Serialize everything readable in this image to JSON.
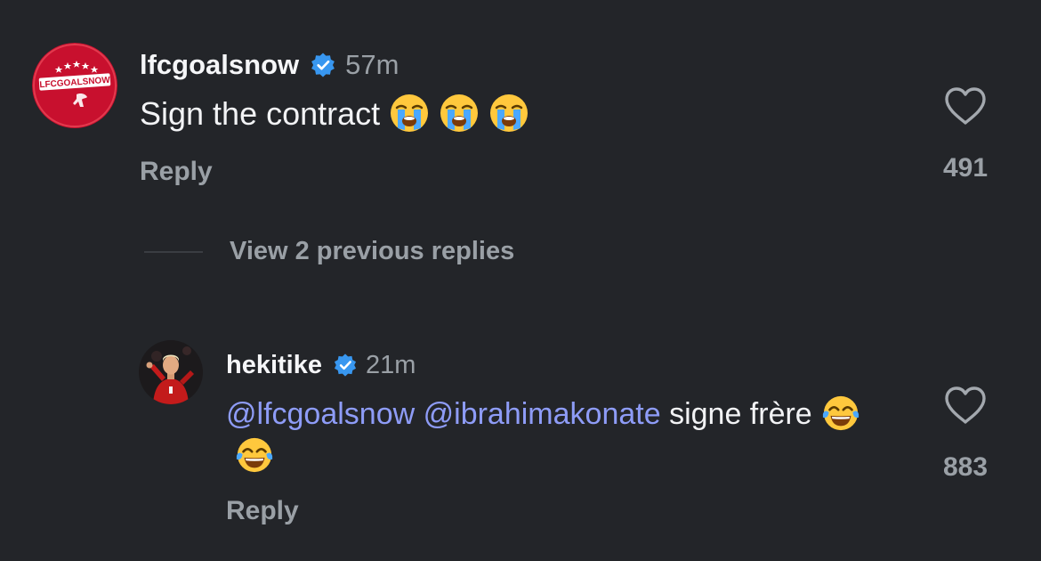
{
  "colors": {
    "background": "#232529",
    "mention": "#8e9cf7",
    "muted": "#9aa0a6",
    "verified": "#3897f0",
    "avatar_red": "#c8102e"
  },
  "comments": [
    {
      "username": "lfcgoalsnow",
      "verified": true,
      "time": "57m",
      "avatar_icon": "lfcgoalsnow-logo",
      "avatar_text": "LFCGOALSNOW",
      "text": "Sign the contract",
      "emojis": [
        "loudly-crying-face",
        "loudly-crying-face",
        "loudly-crying-face"
      ],
      "reply_label": "Reply",
      "like_icon": "heart-outline-icon",
      "like_count": "491"
    },
    {
      "username": "hekitike",
      "verified": true,
      "time": "21m",
      "avatar_icon": "player-photo",
      "mentions": [
        "@lfcgoalsnow",
        "@ibrahimakonate"
      ],
      "text": "signe frère",
      "emojis": [
        "face-with-tears-of-joy",
        "face-with-tears-of-joy"
      ],
      "reply_label": "Reply",
      "like_icon": "heart-outline-icon",
      "like_count": "883"
    }
  ],
  "view_replies_label": "View 2 previous replies"
}
